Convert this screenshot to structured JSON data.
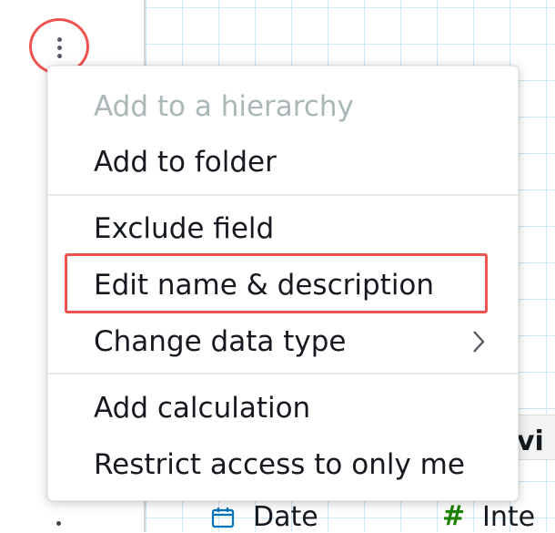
{
  "menu": {
    "items": [
      {
        "label": "Add to a hierarchy",
        "disabled": true
      },
      {
        "label": "Add to folder",
        "disabled": false
      },
      {
        "label": "Exclude field",
        "disabled": false
      },
      {
        "label": "Edit name & description",
        "disabled": false,
        "highlighted": true
      },
      {
        "label": "Change data type",
        "disabled": false,
        "submenu": true
      },
      {
        "label": "Add calculation",
        "disabled": false
      },
      {
        "label": "Restrict access to only me",
        "disabled": false
      }
    ]
  },
  "background": {
    "band_text": "vi",
    "fields": [
      {
        "icon": "calendar-icon",
        "label": "Date"
      },
      {
        "icon": "hash-icon",
        "label": "Inte"
      }
    ]
  },
  "colors": {
    "highlight": "#ef5350",
    "text": "#16191f",
    "disabled_text": "#aab7b8",
    "integer_icon": "#1d8102",
    "date_icon": "#0073bb",
    "grid": "#cfe6f5"
  }
}
